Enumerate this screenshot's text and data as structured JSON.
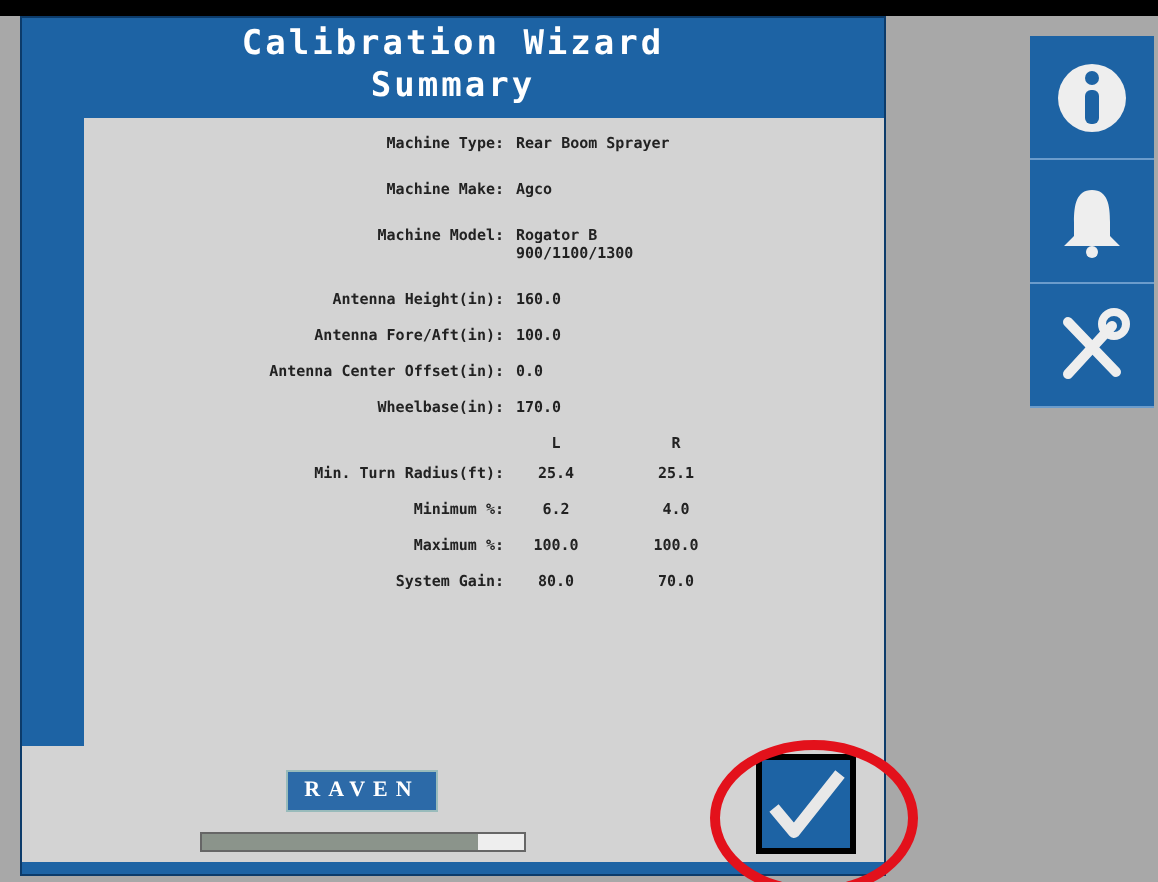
{
  "title": [
    "Calibration Wizard",
    "Summary"
  ],
  "rows": [
    {
      "kind": "field",
      "label": "Machine Type:",
      "values": [
        "Rear Boom Sprayer"
      ]
    },
    {
      "kind": "field",
      "label": "Machine Make:",
      "values": [
        "Agco"
      ]
    },
    {
      "kind": "field",
      "label": "Machine Model:",
      "values": [
        "Rogator B",
        "900/1100/1300"
      ]
    },
    {
      "kind": "field",
      "label": "Antenna Height(in):",
      "values": [
        "160.0"
      ]
    },
    {
      "kind": "field",
      "label": "Antenna Fore/Aft(in):",
      "values": [
        "100.0"
      ]
    },
    {
      "kind": "field",
      "label": "Antenna Center Offset(in):",
      "values": [
        "0.0"
      ]
    },
    {
      "kind": "field",
      "label": "Wheelbase(in):",
      "values": [
        "170.0"
      ]
    },
    {
      "kind": "header",
      "values": [
        "L",
        "R"
      ]
    },
    {
      "kind": "pair",
      "label": "Min. Turn Radius(ft):",
      "values": [
        "25.4",
        "25.1"
      ]
    },
    {
      "kind": "pair",
      "label": "Minimum %:",
      "values": [
        "6.2",
        "4.0"
      ]
    },
    {
      "kind": "pair",
      "label": "Maximum %:",
      "values": [
        "100.0",
        "100.0"
      ]
    },
    {
      "kind": "pair",
      "label": "System Gain:",
      "values": [
        "80.0",
        "70.0"
      ]
    }
  ],
  "logo": "RAVEN",
  "progress": {
    "level": 0.86
  },
  "side_buttons": [
    {
      "kind": "info"
    },
    {
      "kind": "alarm"
    },
    {
      "kind": "tools"
    }
  ],
  "confirm_highlighted": true
}
